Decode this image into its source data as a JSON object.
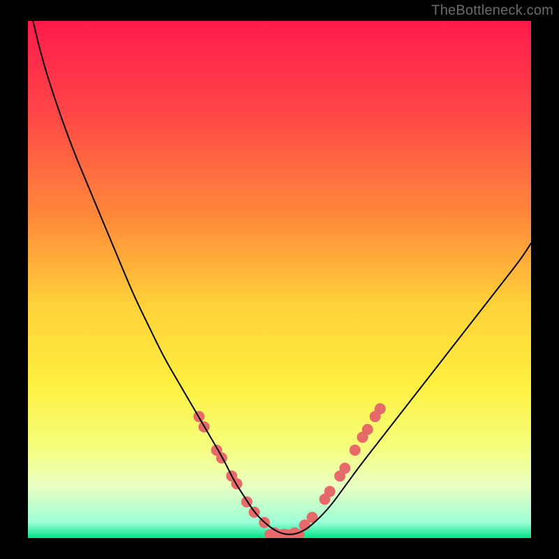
{
  "watermark": "TheBottleneck.com",
  "chart_data": {
    "type": "line",
    "title": "",
    "xlabel": "",
    "ylabel": "",
    "xlim": [
      0,
      100
    ],
    "ylim": [
      0,
      100
    ],
    "legend": false,
    "grid": false,
    "background_gradient": {
      "stops": [
        {
          "offset": 0.0,
          "color": "#ff1a4b"
        },
        {
          "offset": 0.18,
          "color": "#ff4747"
        },
        {
          "offset": 0.38,
          "color": "#ff8a3a"
        },
        {
          "offset": 0.55,
          "color": "#ffd23a"
        },
        {
          "offset": 0.7,
          "color": "#ffef3f"
        },
        {
          "offset": 0.82,
          "color": "#f6ff7a"
        },
        {
          "offset": 0.9,
          "color": "#e9ffc2"
        },
        {
          "offset": 0.97,
          "color": "#9cffd6"
        },
        {
          "offset": 1.0,
          "color": "#00e58a"
        }
      ]
    },
    "series": [
      {
        "name": "bottleneck-curve",
        "color": "#000000",
        "width": 2,
        "x": [
          1,
          3,
          6,
          9,
          12,
          15,
          18,
          21,
          24,
          27,
          30,
          33,
          36,
          39,
          41,
          43,
          45,
          47,
          49,
          51,
          53,
          55,
          57,
          60,
          63,
          66,
          70,
          74,
          78,
          82,
          86,
          90,
          94,
          98,
          100
        ],
        "y": [
          100,
          92,
          83,
          75,
          68,
          61,
          54,
          47,
          41,
          35,
          30,
          25,
          20,
          15,
          11,
          8,
          5,
          3,
          1.5,
          0.7,
          0.7,
          1.5,
          3,
          6,
          10,
          14,
          19,
          24,
          29,
          34,
          39,
          44,
          49,
          54,
          57
        ]
      }
    ],
    "markers": {
      "name": "highlight-dots",
      "color": "#e66a6a",
      "radius": 8,
      "points": [
        {
          "x": 34.0,
          "y": 23.5
        },
        {
          "x": 35.0,
          "y": 21.5
        },
        {
          "x": 37.5,
          "y": 17.0
        },
        {
          "x": 38.5,
          "y": 15.5
        },
        {
          "x": 40.5,
          "y": 12.0
        },
        {
          "x": 41.5,
          "y": 10.5
        },
        {
          "x": 43.5,
          "y": 7.0
        },
        {
          "x": 45.0,
          "y": 5.0
        },
        {
          "x": 47.0,
          "y": 3.0
        },
        {
          "x": 49.0,
          "y": 1.0
        },
        {
          "x": 51.0,
          "y": 0.7
        },
        {
          "x": 53.0,
          "y": 1.0
        },
        {
          "x": 55.0,
          "y": 2.5
        },
        {
          "x": 56.5,
          "y": 4.0
        },
        {
          "x": 59.0,
          "y": 7.5
        },
        {
          "x": 60.0,
          "y": 9.0
        },
        {
          "x": 62.0,
          "y": 12.0
        },
        {
          "x": 63.0,
          "y": 13.5
        },
        {
          "x": 65.0,
          "y": 17.0
        },
        {
          "x": 66.5,
          "y": 19.5
        },
        {
          "x": 67.5,
          "y": 21.0
        },
        {
          "x": 69.0,
          "y": 23.5
        },
        {
          "x": 70.0,
          "y": 25.0
        }
      ]
    },
    "baseline_band": {
      "color": "#e66a6a",
      "y": 0.7,
      "x_start": 47,
      "x_end": 55,
      "thickness": 14
    }
  }
}
